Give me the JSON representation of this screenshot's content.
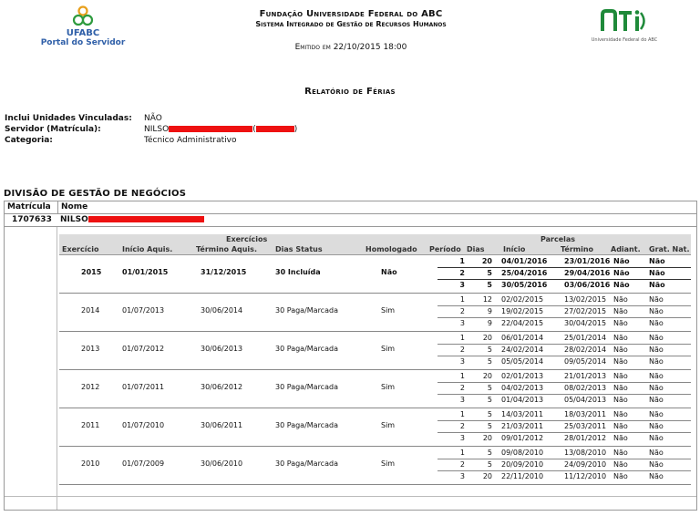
{
  "header": {
    "org_short": "UFABC",
    "portal": "Portal do Servidor",
    "title1": "Fundação Universidade Federal do ABC",
    "title2": "Sistema Integrado de Gestão de Recursos Humanos",
    "emitted": "Emitido em 22/10/2015 18:00",
    "nti_caption": "Universidade Federal do ABC"
  },
  "report_title": "Relatório de Férias",
  "info": {
    "vinc_label": "Inclui Unidades Vinculadas:",
    "vinc_value": "NÃO",
    "servidor_label": "Servidor (Matrícula):",
    "servidor_value": "NILSO",
    "servidor_open": "(",
    "servidor_close": ")",
    "categoria_label": "Categoria:",
    "categoria_value": "Técnico Administrativo"
  },
  "section_title": "DIVISÃO DE GESTÃO DE NEGÓCIOS",
  "outer_headers": {
    "matricula": "Matrícula",
    "nome": "Nome"
  },
  "servidor_row": {
    "matricula": "1707633",
    "nome": "NILSO"
  },
  "group_headers": {
    "exercicios": "Exercícios",
    "parcelas": "Parcelas"
  },
  "columns": {
    "exercicio": "Exercício",
    "inicio_aquis": "Início Aquis.",
    "termino_aquis": "Término Aquis.",
    "dias_status": "Dias Status",
    "homologado": "Homologado",
    "periodo": "Período",
    "dias": "Dias",
    "inicio": "Início",
    "termino": "Término",
    "adiant": "Adiant.",
    "grat": "Grat. Nat."
  },
  "rows": [
    {
      "exercicio": "2015",
      "inicio": "01/01/2015",
      "termino": "31/12/2015",
      "dias_status": "30 Incluída",
      "homologado": "Não",
      "bold": true,
      "parcelas": [
        {
          "p": "1",
          "d": "20",
          "i": "04/01/2016",
          "t": "23/01/2016",
          "a": "Não",
          "g": "Não"
        },
        {
          "p": "2",
          "d": "5",
          "i": "25/04/2016",
          "t": "29/04/2016",
          "a": "Não",
          "g": "Não"
        },
        {
          "p": "3",
          "d": "5",
          "i": "30/05/2016",
          "t": "03/06/2016",
          "a": "Não",
          "g": "Não"
        }
      ]
    },
    {
      "exercicio": "2014",
      "inicio": "01/07/2013",
      "termino": "30/06/2014",
      "dias_status": "30 Paga/Marcada",
      "homologado": "Sim",
      "bold": false,
      "parcelas": [
        {
          "p": "1",
          "d": "12",
          "i": "02/02/2015",
          "t": "13/02/2015",
          "a": "Não",
          "g": "Não"
        },
        {
          "p": "2",
          "d": "9",
          "i": "19/02/2015",
          "t": "27/02/2015",
          "a": "Não",
          "g": "Não"
        },
        {
          "p": "3",
          "d": "9",
          "i": "22/04/2015",
          "t": "30/04/2015",
          "a": "Não",
          "g": "Não"
        }
      ]
    },
    {
      "exercicio": "2013",
      "inicio": "01/07/2012",
      "termino": "30/06/2013",
      "dias_status": "30 Paga/Marcada",
      "homologado": "Sim",
      "bold": false,
      "parcelas": [
        {
          "p": "1",
          "d": "20",
          "i": "06/01/2014",
          "t": "25/01/2014",
          "a": "Não",
          "g": "Não"
        },
        {
          "p": "2",
          "d": "5",
          "i": "24/02/2014",
          "t": "28/02/2014",
          "a": "Não",
          "g": "Não"
        },
        {
          "p": "3",
          "d": "5",
          "i": "05/05/2014",
          "t": "09/05/2014",
          "a": "Não",
          "g": "Não"
        }
      ]
    },
    {
      "exercicio": "2012",
      "inicio": "01/07/2011",
      "termino": "30/06/2012",
      "dias_status": "30 Paga/Marcada",
      "homologado": "Sim",
      "bold": false,
      "parcelas": [
        {
          "p": "1",
          "d": "20",
          "i": "02/01/2013",
          "t": "21/01/2013",
          "a": "Não",
          "g": "Não"
        },
        {
          "p": "2",
          "d": "5",
          "i": "04/02/2013",
          "t": "08/02/2013",
          "a": "Não",
          "g": "Não"
        },
        {
          "p": "3",
          "d": "5",
          "i": "01/04/2013",
          "t": "05/04/2013",
          "a": "Não",
          "g": "Não"
        }
      ]
    },
    {
      "exercicio": "2011",
      "inicio": "01/07/2010",
      "termino": "30/06/2011",
      "dias_status": "30 Paga/Marcada",
      "homologado": "Sim",
      "bold": false,
      "parcelas": [
        {
          "p": "1",
          "d": "5",
          "i": "14/03/2011",
          "t": "18/03/2011",
          "a": "Não",
          "g": "Não"
        },
        {
          "p": "2",
          "d": "5",
          "i": "21/03/2011",
          "t": "25/03/2011",
          "a": "Não",
          "g": "Não"
        },
        {
          "p": "3",
          "d": "20",
          "i": "09/01/2012",
          "t": "28/01/2012",
          "a": "Não",
          "g": "Não"
        }
      ]
    },
    {
      "exercicio": "2010",
      "inicio": "01/07/2009",
      "termino": "30/06/2010",
      "dias_status": "30 Paga/Marcada",
      "homologado": "Sim",
      "bold": false,
      "parcelas": [
        {
          "p": "1",
          "d": "5",
          "i": "09/08/2010",
          "t": "13/08/2010",
          "a": "Não",
          "g": "Não"
        },
        {
          "p": "2",
          "d": "5",
          "i": "20/09/2010",
          "t": "24/09/2010",
          "a": "Não",
          "g": "Não"
        },
        {
          "p": "3",
          "d": "20",
          "i": "22/11/2010",
          "t": "11/12/2010",
          "a": "Não",
          "g": "Não"
        }
      ]
    }
  ]
}
